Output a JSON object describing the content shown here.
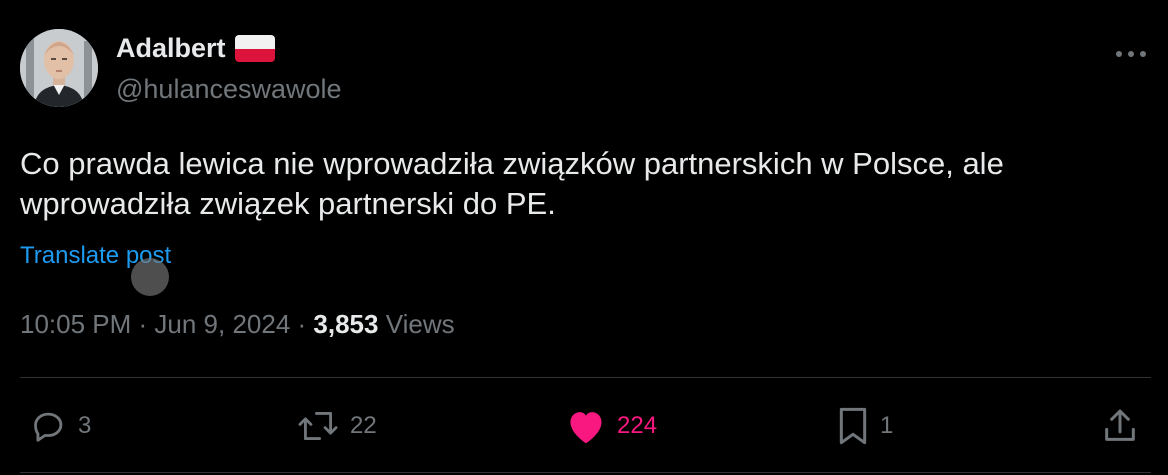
{
  "author": {
    "display_name": "Adalbert",
    "handle": "@hulanceswawole"
  },
  "post": {
    "text": "Co prawda lewica nie wprowadziła związków partnerskich w Polsce, ale wprowadziła związek partnerski do PE.",
    "translate_label": "Translate post"
  },
  "meta": {
    "time": "10:05 PM",
    "separator1": " · ",
    "date": "Jun 9, 2024",
    "separator2": " · ",
    "views_count": "3,853",
    "views_label": " Views"
  },
  "actions": {
    "replies": "3",
    "reposts": "22",
    "likes": "224",
    "bookmarks": "1"
  },
  "colors": {
    "background": "#000000",
    "text": "#e7e9ea",
    "muted": "#71767b",
    "link": "#1d9bf0",
    "like": "#f91880"
  }
}
